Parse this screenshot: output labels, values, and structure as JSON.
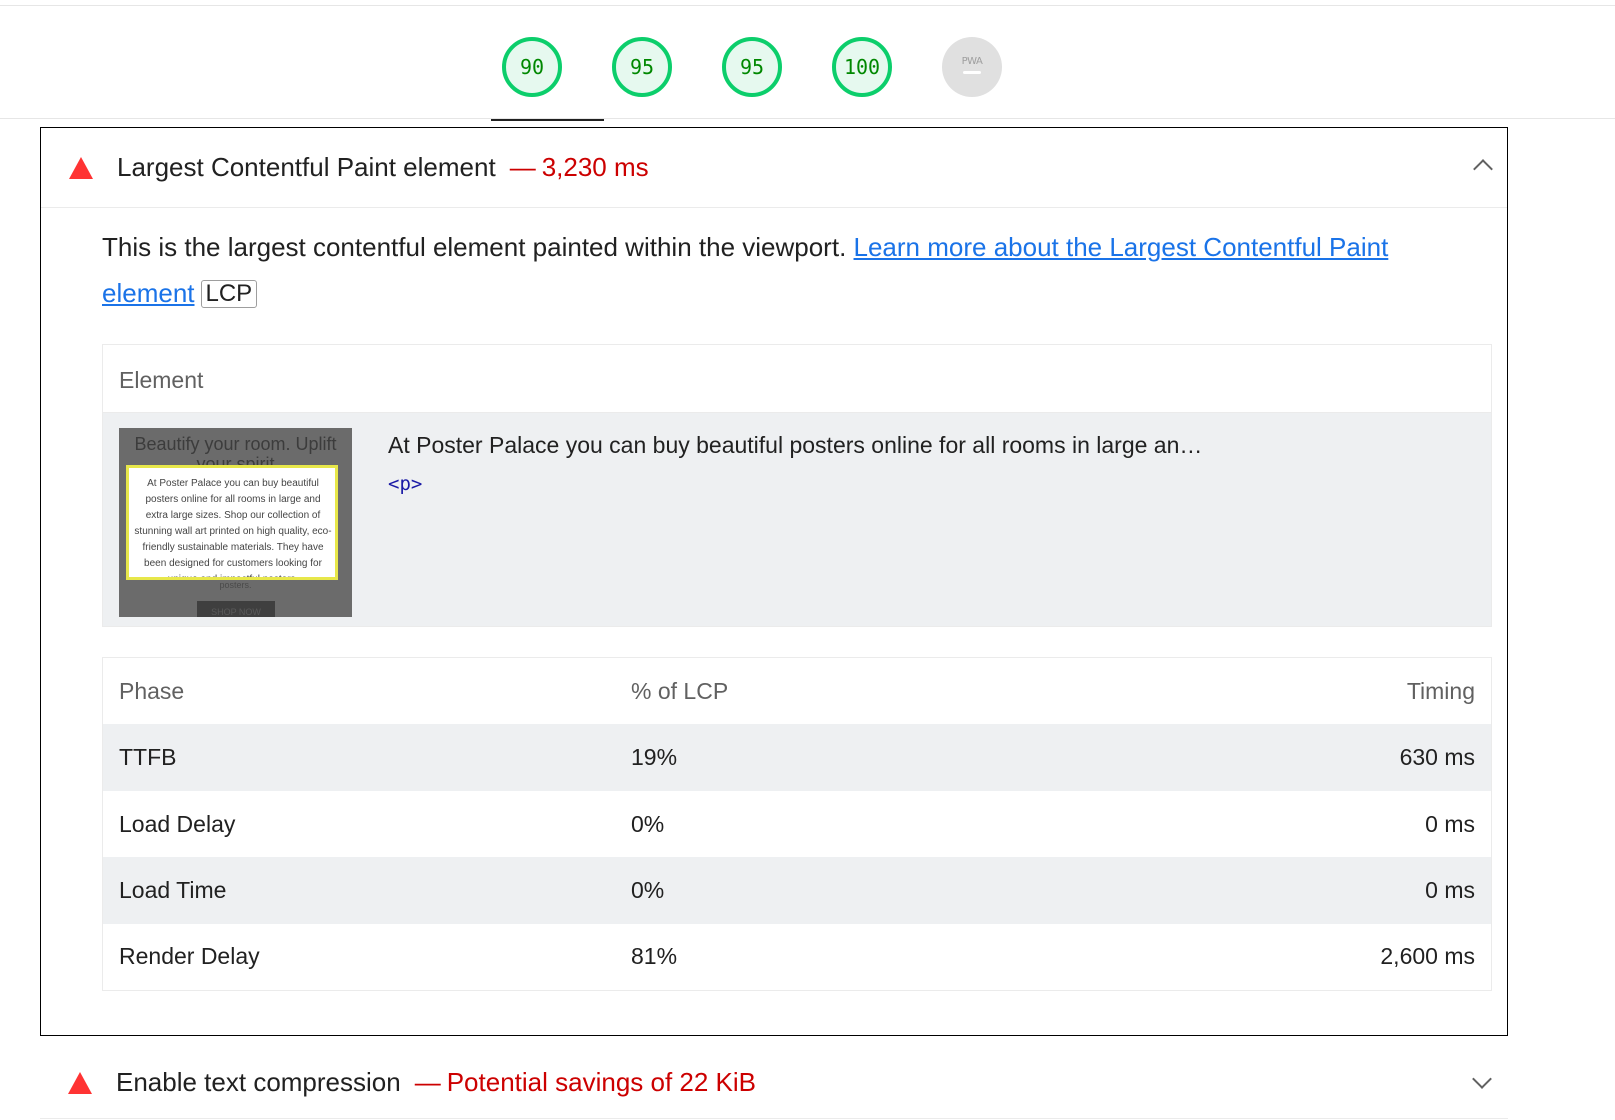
{
  "gauges": [
    {
      "label": "90",
      "kind": "pass"
    },
    {
      "label": "95",
      "kind": "pass"
    },
    {
      "label": "95",
      "kind": "pass"
    },
    {
      "label": "100",
      "kind": "pass"
    },
    {
      "label": "PWA",
      "kind": "na"
    }
  ],
  "audit_expanded": {
    "title": "Largest Contentful Paint element",
    "separator": "—",
    "value": "3,230 ms",
    "description": "This is the largest contentful element painted within the viewport. ",
    "learn_more_link": "Learn more about the Largest Contentful Paint element",
    "badge": "LCP",
    "element_table": {
      "header": "Element",
      "snippet": "At Poster Palace you can buy beautiful posters online for all rooms in large an…",
      "node_tag": "<p>",
      "thumbnail": {
        "heading": "Beautify your room. Uplift your spirit",
        "text": "At Poster Palace you can buy beautiful posters online for all rooms in large and extra large sizes. Shop our collection of stunning wall art printed on high quality, eco-friendly sustainable materials. They have been designed for customers looking for unique and impactful posters.",
        "button": "SHOP NOW"
      }
    },
    "phase_table": {
      "headers": [
        "Phase",
        "% of LCP",
        "Timing"
      ],
      "rows": [
        {
          "phase": "TTFB",
          "pct": "19%",
          "timing": "630 ms"
        },
        {
          "phase": "Load Delay",
          "pct": "0%",
          "timing": "0 ms"
        },
        {
          "phase": "Load Time",
          "pct": "0%",
          "timing": "0 ms"
        },
        {
          "phase": "Render Delay",
          "pct": "81%",
          "timing": "2,600 ms"
        }
      ]
    }
  },
  "audit_collapsed": {
    "title": "Enable text compression",
    "separator": "—",
    "value": "Potential savings of 22 KiB"
  },
  "colors": {
    "pass": "#0cce6b",
    "fail": "#ff3333",
    "fail_text": "#cc0000",
    "link": "#1a73e8"
  }
}
